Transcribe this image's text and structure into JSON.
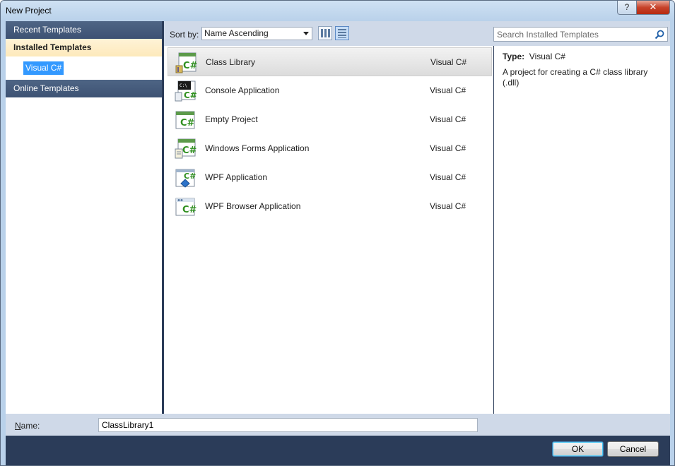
{
  "window": {
    "title": "New Project",
    "help_glyph": "?",
    "close_glyph": "✕"
  },
  "sidebar": {
    "recent": "Recent Templates",
    "installed": "Installed Templates",
    "tree_item": "Visual C#",
    "online": "Online Templates"
  },
  "toolbar": {
    "sort_label": "Sort by:",
    "sort_value": "Name Ascending",
    "search_placeholder": "Search Installed Templates"
  },
  "templates": [
    {
      "name": "Class Library",
      "lang": "Visual C#",
      "icon": "class-library-icon",
      "selected": true
    },
    {
      "name": "Console Application",
      "lang": "Visual C#",
      "icon": "console-app-icon"
    },
    {
      "name": "Empty Project",
      "lang": "Visual C#",
      "icon": "empty-project-icon"
    },
    {
      "name": "Windows Forms Application",
      "lang": "Visual C#",
      "icon": "windows-forms-icon"
    },
    {
      "name": "WPF Application",
      "lang": "Visual C#",
      "icon": "wpf-app-icon"
    },
    {
      "name": "WPF Browser Application",
      "lang": "Visual C#",
      "icon": "wpf-browser-icon"
    }
  ],
  "details": {
    "type_label": "Type:",
    "type_value": "Visual C#",
    "description": "A project for creating a C# class library (.dll)"
  },
  "namebar": {
    "label_underlined": "N",
    "label_rest": "ame:",
    "value": "ClassLibrary1"
  },
  "buttons": {
    "ok": "OK",
    "cancel": "Cancel"
  },
  "colors": {
    "selection": "#3399ff",
    "csharp_green": "#2f8f1f",
    "header_navy": "#3d5273"
  }
}
